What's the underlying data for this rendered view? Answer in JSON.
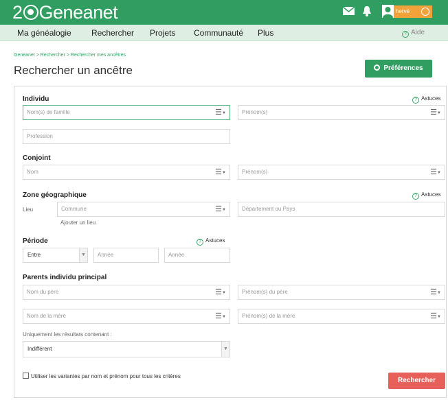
{
  "brand": {
    "logo_prefix": "2",
    "logo_name": "Geneanet",
    "user_name": "hervé"
  },
  "menu": {
    "items": [
      "Ma généalogie",
      "Rechercher",
      "Projets",
      "Communauté",
      "Plus"
    ],
    "aide": "Aide"
  },
  "page": {
    "breadcrumb": "Geneanet > Rechercher > Rechercher mes ancêtres",
    "title": "Rechercher un ancêtre",
    "preferences": "Préférences"
  },
  "form": {
    "astuces": "Astuces",
    "individu": {
      "title": "Individu",
      "nom_placeholder": "Nom(s) de famille",
      "prenom_placeholder": "Prénom(s)",
      "profession_placeholder": "Profession"
    },
    "conjoint": {
      "title": "Conjoint",
      "nom_placeholder": "Nom",
      "prenom_placeholder": "Prénom(s)"
    },
    "zone": {
      "title": "Zone géographique",
      "lieu_label": "Lieu",
      "commune_placeholder": "Commune",
      "departement_placeholder": "Département ou Pays",
      "ajouter_lieu": "Ajouter un lieu"
    },
    "periode": {
      "title": "Période",
      "mode_value": "Entre",
      "annee1_placeholder": "Année",
      "annee2_placeholder": "Année"
    },
    "parents": {
      "title": "Parents individu principal",
      "pere_nom": "Nom du père",
      "pere_prenom": "Prénom(s) du père",
      "mere_nom": "Nom de la mère",
      "mere_prenom": "Prénom(s) de la mère"
    },
    "filter": {
      "label": "Uniquement les résultats contenant :",
      "value": "Indifférent"
    },
    "variantes_label": "Utiliser les variantes par nom et prénom pour tous les critères",
    "submit": "Rechercher"
  },
  "colors": {
    "brand_green": "#2f9e60",
    "submit_red": "#e8605a",
    "user_orange": "#f2a23a"
  }
}
